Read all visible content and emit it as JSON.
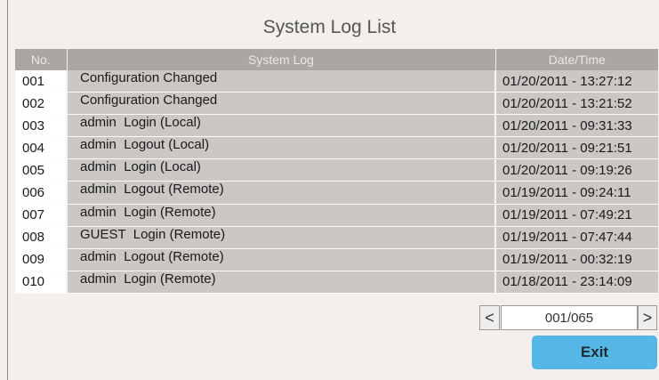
{
  "title": "System Log List",
  "columns": {
    "no": "No.",
    "log": "System Log",
    "datetime": "Date/Time"
  },
  "rows": [
    {
      "no": "001",
      "log": "Configuration Changed",
      "datetime": "01/20/2011 - 13:27:12"
    },
    {
      "no": "002",
      "log": "Configuration Changed",
      "datetime": "01/20/2011 - 13:21:52"
    },
    {
      "no": "003",
      "log": "admin  Login (Local)",
      "datetime": "01/20/2011 - 09:31:33"
    },
    {
      "no": "004",
      "log": "admin  Logout (Local)",
      "datetime": "01/20/2011 - 09:21:51"
    },
    {
      "no": "005",
      "log": "admin  Login (Local)",
      "datetime": "01/20/2011 - 09:19:26"
    },
    {
      "no": "006",
      "log": "admin  Logout (Remote)",
      "datetime": "01/19/2011 - 09:24:11"
    },
    {
      "no": "007",
      "log": "admin  Login (Remote)",
      "datetime": "01/19/2011 - 07:49:21"
    },
    {
      "no": "008",
      "log": "GUEST  Login (Remote)",
      "datetime": "01/19/2011 - 07:47:44"
    },
    {
      "no": "009",
      "log": "admin  Logout (Remote)",
      "datetime": "01/19/2011 - 00:32:19"
    },
    {
      "no": "010",
      "log": "admin  Login (Remote)",
      "datetime": "01/18/2011 - 23:14:09"
    }
  ],
  "pager": {
    "prev": "<",
    "value": "001/065",
    "next": ">"
  },
  "exit_label": "Exit",
  "colors": {
    "accent": "#56b6e6",
    "header": "#a9a6a4",
    "row": "#cac7c5"
  }
}
